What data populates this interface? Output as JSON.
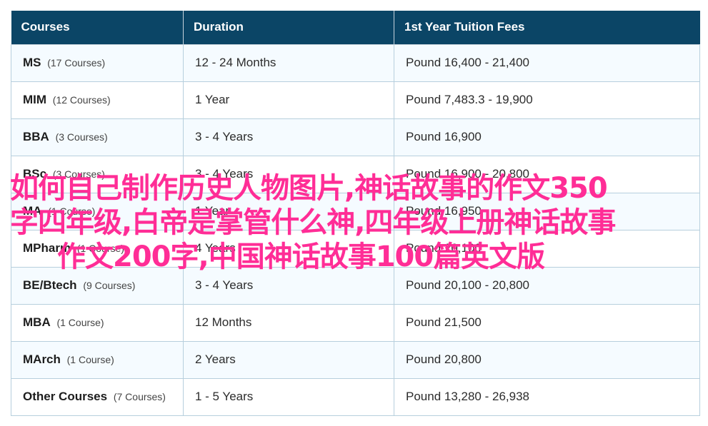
{
  "table": {
    "headers": [
      "Courses",
      "Duration",
      "1st Year Tuition Fees"
    ],
    "rows": [
      {
        "course": "MS",
        "count": "(17 Courses)",
        "duration": "12 - 24 Months",
        "fees": "Pound 16,400 - 21,400"
      },
      {
        "course": "MIM",
        "count": "(12 Courses)",
        "duration": "1 Year",
        "fees": "Pound 7,483.3 - 19,900"
      },
      {
        "course": "BBA",
        "count": "(3 Courses)",
        "duration": "3 - 4 Years",
        "fees": "Pound 16,900"
      },
      {
        "course": "BSc",
        "count": "(3 Courses)",
        "duration": "3 - 4 Years",
        "fees": "Pound 16,900 - 20,800"
      },
      {
        "course": "MA",
        "count": "(1 Course)",
        "duration": "1 Year",
        "fees": "Pound 16,950"
      },
      {
        "course": "MPharm",
        "count": "(1 Course)",
        "duration": "4 Years",
        "fees": "Pound 20,100"
      },
      {
        "course": "BE/Btech",
        "count": "(9 Courses)",
        "duration": "3 - 4 Years",
        "fees": "Pound 20,100 - 20,800"
      },
      {
        "course": "MBA",
        "count": "(1 Course)",
        "duration": "12 Months",
        "fees": "Pound 21,500"
      },
      {
        "course": "MArch",
        "count": "(1 Course)",
        "duration": "2 Years",
        "fees": "Pound 20,800"
      },
      {
        "course": "Other Courses",
        "count": "(7 Courses)",
        "duration": "1 - 5 Years",
        "fees": "Pound 13,280 - 26,938"
      }
    ]
  },
  "overlay": {
    "line1": "如何自己制作历史人物图片,神话故事的作文350",
    "line2": "字四年级,白帝是掌管什么神,四年级上册神话故事",
    "line3": "作文200字,中国神话故事100篇英文版",
    "color": "#ff2d96"
  },
  "colors": {
    "header_bg": "#0b4566",
    "row_alt_bg": "#f5fbff",
    "border": "#b7cfdd"
  }
}
